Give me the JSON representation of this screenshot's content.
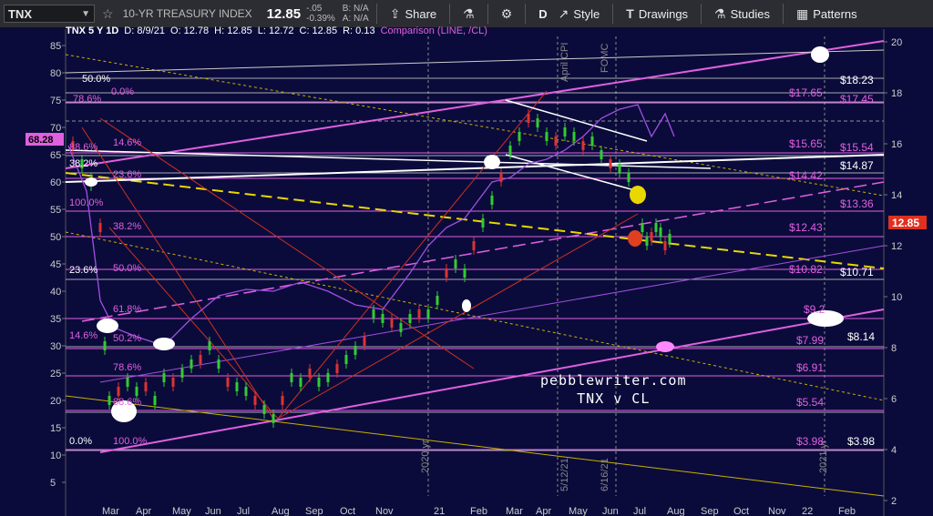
{
  "toolbar": {
    "symbol": "TNX",
    "name": "10-YR TREASURY INDEX",
    "price": "12.85",
    "change": "-.05",
    "change_pct": "-0.39%",
    "bid": "B: N/A",
    "ask": "A: N/A",
    "share_label": "Share",
    "period": "D",
    "style_label": "Style",
    "drawings_label": "Drawings",
    "studies_label": "Studies",
    "patterns_label": "Patterns"
  },
  "header": {
    "title": "TNX 5 Y 1D",
    "date": "D: 8/9/21",
    "open": "O: 12.78",
    "high": "H: 12.85",
    "low": "L: 12.72",
    "close": "C: 12.85",
    "range": "R: 0.13",
    "comparison": "Comparison (LINE, /CL)"
  },
  "watermark": {
    "line1": "pebblewriter.com",
    "line2": "TNX v CL"
  },
  "left_axis": {
    "ticks": [
      "85",
      "80",
      "75",
      "70",
      "65",
      "60",
      "55",
      "50",
      "45",
      "40",
      "35",
      "30",
      "25",
      "20",
      "15",
      "10",
      "5"
    ],
    "badge": "68.28"
  },
  "right_axis": {
    "ticks": [
      "20",
      "18",
      "16",
      "14",
      "12",
      "10",
      "8",
      "6",
      "4",
      "2"
    ],
    "badge": "12.85"
  },
  "x_axis": [
    "Mar",
    "Apr",
    "May",
    "Jun",
    "Jul",
    "Aug",
    "Sep",
    "Oct",
    "Nov",
    "21",
    "Feb",
    "Mar",
    "Apr",
    "May",
    "Jun",
    "Jul",
    "Aug",
    "Sep",
    "Oct",
    "Nov",
    "22",
    "Feb"
  ],
  "vertical_labels": [
    "2020 yr",
    "April CPI",
    "FOMC",
    "5/12/21",
    "6/16/21",
    "2021 yr"
  ],
  "fib_left": [
    "50.0%",
    "78.6%",
    "0.0%",
    "88.6%",
    "14.6%",
    "38.2%",
    "23.6%",
    "100.0%",
    "38.2%",
    "23.6%",
    "50.0%",
    "61.8%",
    "14.6%",
    "50.2%",
    "78.6%",
    "88.6%",
    "0.0%",
    "100.0%"
  ],
  "price_labels_pink": [
    "$17.65",
    "$17.45",
    "$15.65",
    "$15.54",
    "$14.42",
    "$13.36",
    "$12.43",
    "$10.82",
    "$9.2",
    "$7.99",
    "$6.91",
    "$5.54",
    "$3.98"
  ],
  "price_labels_white": [
    "$18.23",
    "$14.87",
    "$10.71",
    "$8.14",
    "$3.98"
  ],
  "colors": {
    "background": "#0b0b3b",
    "pink": "#e060e0",
    "yellow": "#e8d800",
    "red": "#d03020",
    "white": "#ffffff",
    "purple": "#a050e0"
  }
}
